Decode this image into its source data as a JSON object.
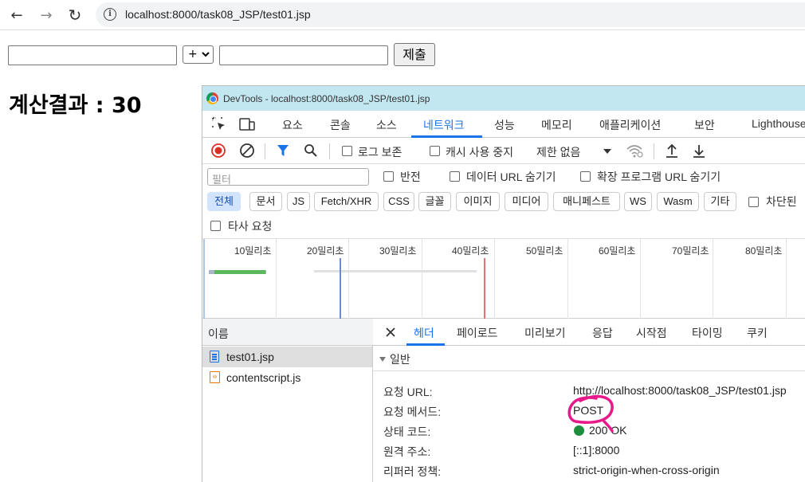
{
  "browser": {
    "url": "localhost:8000/task08_JSP/test01.jsp",
    "back_glyph": "←",
    "forward_glyph": "→",
    "reload_glyph": "↻"
  },
  "form": {
    "operator_value": "+",
    "submit_label": "제출"
  },
  "result_text": "계산결과 : 30",
  "devtools": {
    "title": "DevTools - localhost:8000/task08_JSP/test01.jsp",
    "tabs": [
      "요소",
      "콘솔",
      "소스",
      "네트워크",
      "성능",
      "메모리",
      "애플리케이션",
      "보안",
      "Lighthouse"
    ],
    "active_tab": "네트워크",
    "toolbar": {
      "preserve_log": "로그 보존",
      "disable_cache": "캐시 사용 중지",
      "throttle": "제한 없음"
    },
    "filter": {
      "placeholder": "필터",
      "invert": "반전",
      "hide_data_urls": "데이터 URL 숨기기",
      "hide_extension_urls": "확장 프로그램 URL 숨기기"
    },
    "types": [
      "전체",
      "문서",
      "JS",
      "Fetch/XHR",
      "CSS",
      "글꼴",
      "이미지",
      "미디어",
      "매니페스트",
      "WS",
      "Wasm",
      "기타"
    ],
    "blocked": "차단된",
    "third_party": "타사 요청",
    "timeline_ticks": [
      "10밀리초",
      "20밀리초",
      "30밀리초",
      "40밀리초",
      "50밀리초",
      "60밀리초",
      "70밀리초",
      "80밀리초"
    ],
    "name_header": "이름",
    "requests": [
      "test01.jsp",
      "contentscript.js"
    ],
    "detail_tabs": [
      "헤더",
      "페이로드",
      "미리보기",
      "응답",
      "시작점",
      "타이밍",
      "쿠키"
    ],
    "general_label": "일반",
    "general": [
      {
        "key": "요청 URL:",
        "value": "http://localhost:8000/task08_JSP/test01.jsp"
      },
      {
        "key": "요청 메서드:",
        "value": "POST"
      },
      {
        "key": "상태 코드:",
        "value": "200 OK"
      },
      {
        "key": "원격 주소:",
        "value": "[::1]:8000"
      },
      {
        "key": "리퍼러 정책:",
        "value": "strict-origin-when-cross-origin"
      }
    ],
    "colors": {
      "accent": "#1a73e8",
      "status_ok": "#1e8e3e",
      "annotation": "#e8198b"
    }
  }
}
